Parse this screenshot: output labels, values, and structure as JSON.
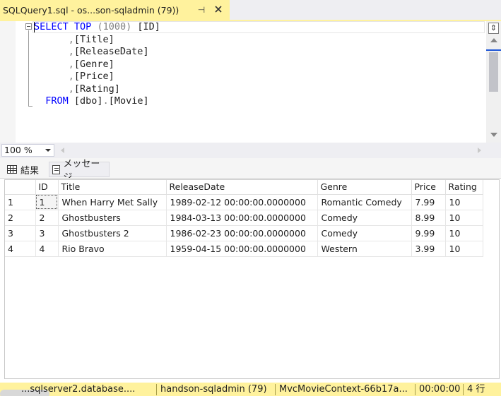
{
  "tab": {
    "title": "SQLQuery1.sql - os...son-sqladmin (79))",
    "pin_glyph": "⊣",
    "close_glyph": "✕"
  },
  "editor": {
    "lines": [
      [
        {
          "t": "SELECT",
          "c": "kw"
        },
        {
          "t": " ",
          "c": "id"
        },
        {
          "t": "TOP",
          "c": "kw"
        },
        {
          "t": " (1000) ",
          "c": "gr"
        },
        {
          "t": "[ID]",
          "c": "id"
        }
      ],
      [
        {
          "t": "      ,",
          "c": "gr"
        },
        {
          "t": "[Title]",
          "c": "id"
        }
      ],
      [
        {
          "t": "      ,",
          "c": "gr"
        },
        {
          "t": "[ReleaseDate]",
          "c": "id"
        }
      ],
      [
        {
          "t": "      ,",
          "c": "gr"
        },
        {
          "t": "[Genre]",
          "c": "id"
        }
      ],
      [
        {
          "t": "      ,",
          "c": "gr"
        },
        {
          "t": "[Price]",
          "c": "id"
        }
      ],
      [
        {
          "t": "      ,",
          "c": "gr"
        },
        {
          "t": "[Rating]",
          "c": "id"
        }
      ],
      [
        {
          "t": "  ",
          "c": "id"
        },
        {
          "t": "FROM",
          "c": "kw"
        },
        {
          "t": " ",
          "c": "id"
        },
        {
          "t": "[dbo]",
          "c": "id"
        },
        {
          "t": ".",
          "c": "gr"
        },
        {
          "t": "[Movie]",
          "c": "id"
        }
      ]
    ]
  },
  "zoom": {
    "value": "100 %"
  },
  "results_tabs": {
    "results_label": "結果",
    "messages_label": "メッセージ"
  },
  "grid": {
    "columns": [
      "",
      "ID",
      "Title",
      "ReleaseDate",
      "Genre",
      "Price",
      "Rating"
    ],
    "rows": [
      [
        "1",
        "1",
        "When Harry Met Sally",
        "1989-02-12 00:00:00.0000000",
        "Romantic Comedy",
        "7.99",
        "10"
      ],
      [
        "2",
        "2",
        "Ghostbusters",
        "1984-03-13 00:00:00.0000000",
        "Comedy",
        "8.99",
        "10"
      ],
      [
        "3",
        "3",
        "Ghostbusters 2",
        "1986-02-23 00:00:00.0000000",
        "Comedy",
        "9.99",
        "10"
      ],
      [
        "4",
        "4",
        "Rio Bravo",
        "1959-04-15 00:00:00.0000000",
        "Western",
        "3.99",
        "10"
      ]
    ]
  },
  "status": {
    "server": "...sqlserver2.database....",
    "user": "handson-sqladmin (79)",
    "database": "MvcMovieContext-66b17a...",
    "elapsed": "00:00:00",
    "row_count": "4 行"
  },
  "colors": {
    "tab_accent": "#fff29d",
    "keyword": "#0000ff",
    "punctuation": "#808080",
    "scroll_marker": "#1e56d6"
  }
}
